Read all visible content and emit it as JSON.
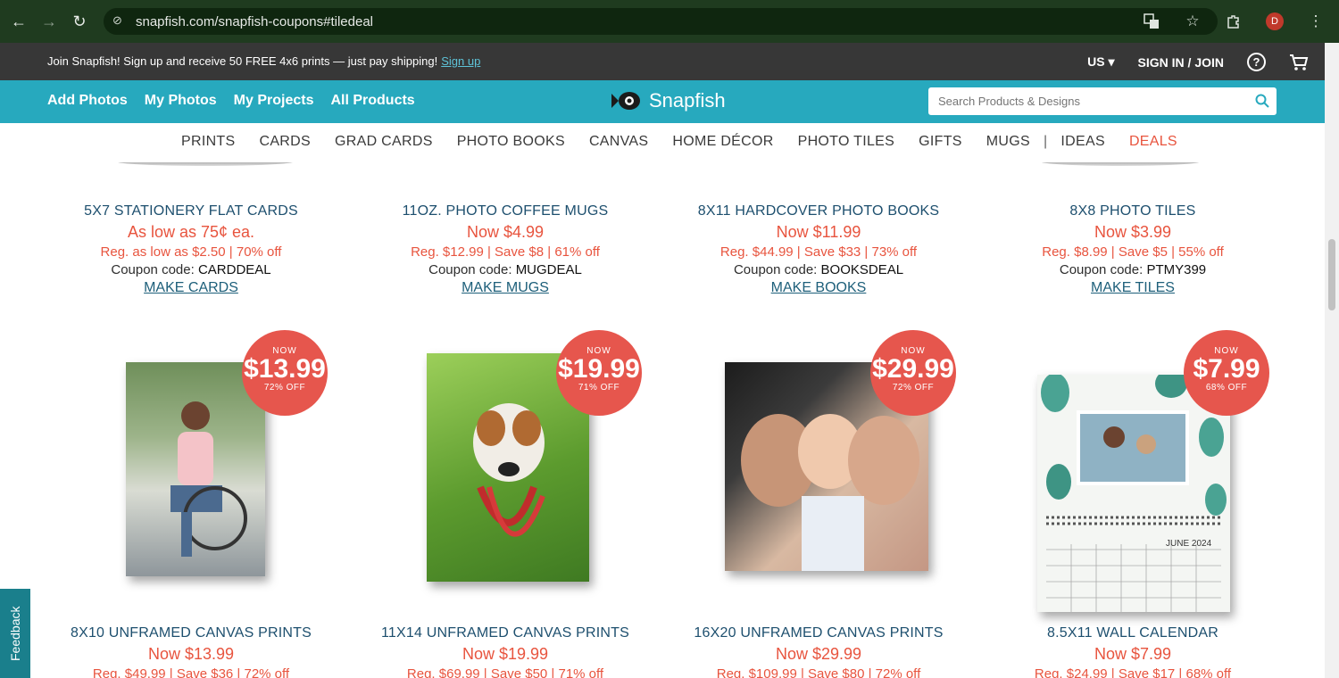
{
  "browser": {
    "url": "snapfish.com/snapfish-coupons#tiledeal",
    "profile_initial": "D"
  },
  "promo": {
    "message": "Join Snapfish! Sign up and receive 50 FREE 4x6 prints — just pay shipping!",
    "signup_link": "Sign up",
    "region": "US ▾",
    "signin": "SIGN IN / JOIN",
    "help": "?"
  },
  "mainnav": {
    "items": [
      "Add Photos",
      "My Photos",
      "My Projects",
      "All Products"
    ],
    "logo": "Snapfish",
    "search_placeholder": "Search Products & Designs"
  },
  "catnav": {
    "items": [
      "PRINTS",
      "CARDS",
      "GRAD CARDS",
      "PHOTO BOOKS",
      "CANVAS",
      "HOME DÉCOR",
      "PHOTO TILES",
      "GIFTS",
      "MUGS"
    ],
    "ideas": "IDEAS",
    "deals": "DEALS"
  },
  "top_products": [
    {
      "title": "5X7 STATIONERY FLAT CARDS",
      "now": "As low as 75¢ ea.",
      "reg": "Reg. as low as $2.50 | 70% off",
      "coupon_label": "Coupon code:",
      "coupon": "CARDDEAL",
      "cta": "MAKE CARDS"
    },
    {
      "title": "11OZ. PHOTO COFFEE MUGS",
      "now": "Now $4.99",
      "reg": "Reg. $12.99 | Save $8 | 61% off",
      "coupon_label": "Coupon code:",
      "coupon": "MUGDEAL",
      "cta": "MAKE MUGS"
    },
    {
      "title": "8X11 HARDCOVER PHOTO BOOKS",
      "now": "Now $11.99",
      "reg": "Reg. $44.99 | Save $33 | 73% off",
      "coupon_label": "Coupon code:",
      "coupon": "BOOKSDEAL",
      "cta": "MAKE BOOKS"
    },
    {
      "title": "8X8 PHOTO TILES",
      "now": "Now $3.99",
      "reg": "Reg. $8.99 | Save $5 | 55% off",
      "coupon_label": "Coupon code:",
      "coupon": "PTMY399",
      "cta": "MAKE TILES"
    }
  ],
  "tiles": [
    {
      "badge_now": "NOW",
      "badge_price": "$13.99",
      "badge_off": "72% OFF",
      "title": "8X10 UNFRAMED CANVAS PRINTS",
      "now": "Now $13.99",
      "reg": "Reg. $49.99 | Save $36 | 72% off"
    },
    {
      "badge_now": "NOW",
      "badge_price": "$19.99",
      "badge_off": "71% OFF",
      "title": "11X14 UNFRAMED CANVAS PRINTS",
      "now": "Now $19.99",
      "reg": "Reg. $69.99 | Save $50 | 71% off"
    },
    {
      "badge_now": "NOW",
      "badge_price": "$29.99",
      "badge_off": "72% OFF",
      "title": "16X20 UNFRAMED CANVAS PRINTS",
      "now": "Now $29.99",
      "reg": "Reg. $109.99 | Save $80 | 72% off"
    },
    {
      "badge_now": "NOW",
      "badge_price": "$7.99",
      "badge_off": "68% OFF",
      "title": "8.5X11 WALL CALENDAR",
      "now": "Now $7.99",
      "reg": "Reg. $24.99 | Save $17 | 68% off",
      "calendar_month": "JUNE 2024"
    }
  ],
  "feedback": "Feedback",
  "colors": {
    "teal": "#27a9be",
    "coral": "#e6564d",
    "navy_text": "#1d4f6e"
  }
}
